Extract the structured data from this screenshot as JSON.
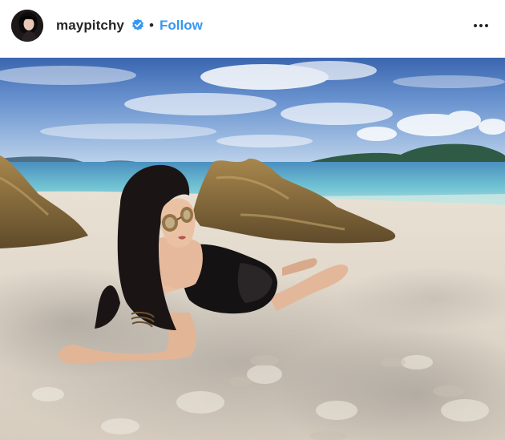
{
  "post": {
    "author": {
      "username": "maypitchy",
      "verified": true,
      "avatar_icon": "profile-photo-avatar"
    },
    "separator": "•",
    "follow_label": "Follow",
    "more_icon": "more-options-icon",
    "photo": {
      "subject": "beach-photo"
    }
  },
  "colors": {
    "follow": "#3897f0",
    "verified_badge": "#3897f0",
    "username": "#262626"
  }
}
